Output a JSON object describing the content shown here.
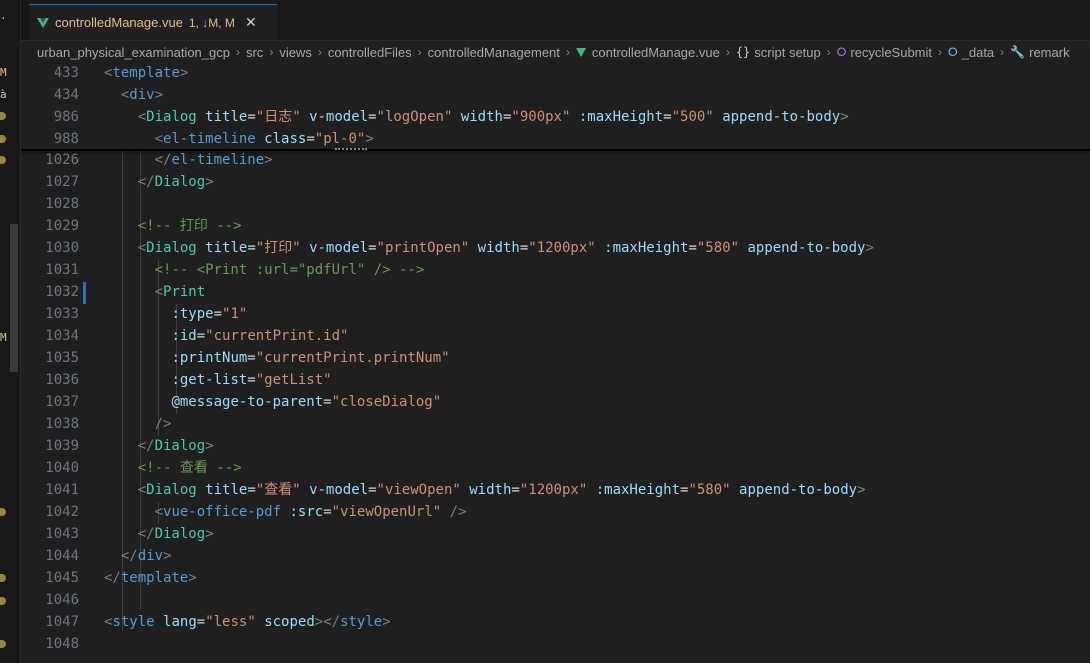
{
  "tab": {
    "filename": "controlledManage.vue",
    "status": "1, ↓M, M",
    "close": "✕"
  },
  "left_strip": {
    "marks": [
      "·",
      "M",
      "à",
      "M"
    ]
  },
  "breadcrumb": [
    {
      "label": "urban_physical_examination_gcp",
      "icon": ""
    },
    {
      "label": "src",
      "icon": ""
    },
    {
      "label": "views",
      "icon": ""
    },
    {
      "label": "controlledFiles",
      "icon": ""
    },
    {
      "label": "controlledManagement",
      "icon": ""
    },
    {
      "label": "controlledManage.vue",
      "icon": "vue-icon"
    },
    {
      "label": "script setup",
      "icon": "braces-icon"
    },
    {
      "label": "recycleSubmit",
      "icon": "method-icon"
    },
    {
      "label": "_data",
      "icon": "field-icon"
    },
    {
      "label": "remark",
      "icon": "wrench-icon"
    }
  ],
  "icon_glyphs": {
    "braces-icon": "{}",
    "method-icon": "⭘",
    "field-icon": "⭘",
    "wrench-icon": "🔧"
  },
  "colors": {
    "accent": "#0078d4",
    "modified": "#e2c08d",
    "tag": "#569cd6",
    "attribute": "#9cdcfe",
    "string": "#ce9178",
    "comment": "#6a9955"
  },
  "sticky_lines": [
    {
      "number": "433",
      "tokens": [
        [
          "t-br",
          "<"
        ],
        [
          "t-tag",
          "template"
        ],
        [
          "t-br",
          ">"
        ]
      ]
    },
    {
      "number": "434",
      "tokens": [
        [
          "t-plain",
          "  "
        ],
        [
          "t-br",
          "<"
        ],
        [
          "t-tag",
          "div"
        ],
        [
          "t-br",
          ">"
        ]
      ]
    },
    {
      "number": "986",
      "tokens": [
        [
          "t-plain",
          "    "
        ],
        [
          "t-br",
          "<"
        ],
        [
          "t-comp",
          "Dialog"
        ],
        [
          "t-plain",
          " "
        ],
        [
          "t-attr",
          "title"
        ],
        [
          "t-eq",
          "="
        ],
        [
          "t-str",
          "\"日志\""
        ],
        [
          "t-plain",
          " "
        ],
        [
          "t-attr",
          "v-model"
        ],
        [
          "t-eq",
          "="
        ],
        [
          "t-str",
          "\"logOpen\""
        ],
        [
          "t-plain",
          " "
        ],
        [
          "t-attr",
          "width"
        ],
        [
          "t-eq",
          "="
        ],
        [
          "t-str",
          "\"900px\""
        ],
        [
          "t-plain",
          " "
        ],
        [
          "t-attr",
          ":maxHeight"
        ],
        [
          "t-eq",
          "="
        ],
        [
          "t-str",
          "\"500\""
        ],
        [
          "t-plain",
          " "
        ],
        [
          "t-attr",
          "append-to-body"
        ],
        [
          "t-br",
          ">"
        ]
      ]
    },
    {
      "number": "988",
      "tokens": [
        [
          "t-plain",
          "      "
        ],
        [
          "t-br",
          "<"
        ],
        [
          "t-tag",
          "el-timeline"
        ],
        [
          "t-plain",
          " "
        ],
        [
          "t-attr",
          "class"
        ],
        [
          "t-eq",
          "="
        ],
        [
          "t-str",
          "\"pl-0\""
        ],
        [
          "t-br",
          ">"
        ]
      ]
    }
  ],
  "lines": [
    {
      "number": "1026",
      "tokens": [
        [
          "t-plain",
          "      "
        ],
        [
          "t-br",
          "</"
        ],
        [
          "t-tag",
          "el-timeline"
        ],
        [
          "t-br",
          ">"
        ]
      ]
    },
    {
      "number": "1027",
      "tokens": [
        [
          "t-plain",
          "    "
        ],
        [
          "t-br",
          "</"
        ],
        [
          "t-comp",
          "Dialog"
        ],
        [
          "t-br",
          ">"
        ]
      ]
    },
    {
      "number": "1028",
      "tokens": []
    },
    {
      "number": "1029",
      "tokens": [
        [
          "t-plain",
          "    "
        ],
        [
          "t-comment",
          "<!-- 打印 -->"
        ]
      ]
    },
    {
      "number": "1030",
      "tokens": [
        [
          "t-plain",
          "    "
        ],
        [
          "t-br",
          "<"
        ],
        [
          "t-comp",
          "Dialog"
        ],
        [
          "t-plain",
          " "
        ],
        [
          "t-attr",
          "title"
        ],
        [
          "t-eq",
          "="
        ],
        [
          "t-str",
          "\"打印\""
        ],
        [
          "t-plain",
          " "
        ],
        [
          "t-attr",
          "v-model"
        ],
        [
          "t-eq",
          "="
        ],
        [
          "t-str",
          "\"printOpen\""
        ],
        [
          "t-plain",
          " "
        ],
        [
          "t-attr",
          "width"
        ],
        [
          "t-eq",
          "="
        ],
        [
          "t-str",
          "\"1200px\""
        ],
        [
          "t-plain",
          " "
        ],
        [
          "t-attr",
          ":maxHeight"
        ],
        [
          "t-eq",
          "="
        ],
        [
          "t-str",
          "\"580\""
        ],
        [
          "t-plain",
          " "
        ],
        [
          "t-attr",
          "append-to-body"
        ],
        [
          "t-br",
          ">"
        ]
      ]
    },
    {
      "number": "1031",
      "tokens": [
        [
          "t-plain",
          "      "
        ],
        [
          "t-comment",
          "<!-- <Print :url=\"pdfUrl\" /> -->"
        ]
      ]
    },
    {
      "number": "1032",
      "tokens": [
        [
          "t-plain",
          "      "
        ],
        [
          "t-br",
          "<"
        ],
        [
          "t-comp",
          "Print"
        ]
      ]
    },
    {
      "number": "1033",
      "tokens": [
        [
          "t-plain",
          "        "
        ],
        [
          "t-attr",
          ":type"
        ],
        [
          "t-eq",
          "="
        ],
        [
          "t-str",
          "\"1\""
        ]
      ]
    },
    {
      "number": "1034",
      "tokens": [
        [
          "t-plain",
          "        "
        ],
        [
          "t-attr",
          ":id"
        ],
        [
          "t-eq",
          "="
        ],
        [
          "t-str",
          "\"currentPrint.id\""
        ]
      ]
    },
    {
      "number": "1035",
      "tokens": [
        [
          "t-plain",
          "        "
        ],
        [
          "t-attr",
          ":printNum"
        ],
        [
          "t-eq",
          "="
        ],
        [
          "t-str",
          "\"currentPrint.printNum\""
        ]
      ]
    },
    {
      "number": "1036",
      "tokens": [
        [
          "t-plain",
          "        "
        ],
        [
          "t-attr",
          ":get-list"
        ],
        [
          "t-eq",
          "="
        ],
        [
          "t-str",
          "\"getList\""
        ]
      ]
    },
    {
      "number": "1037",
      "tokens": [
        [
          "t-plain",
          "        "
        ],
        [
          "t-attr",
          "@message-to-parent"
        ],
        [
          "t-eq",
          "="
        ],
        [
          "t-str",
          "\"closeDialog\""
        ]
      ]
    },
    {
      "number": "1038",
      "tokens": [
        [
          "t-plain",
          "      "
        ],
        [
          "t-br",
          "/>"
        ]
      ]
    },
    {
      "number": "1039",
      "tokens": [
        [
          "t-plain",
          "    "
        ],
        [
          "t-br",
          "</"
        ],
        [
          "t-comp",
          "Dialog"
        ],
        [
          "t-br",
          ">"
        ]
      ]
    },
    {
      "number": "1040",
      "tokens": [
        [
          "t-plain",
          "    "
        ],
        [
          "t-comment",
          "<!-- 查看 -->"
        ]
      ]
    },
    {
      "number": "1041",
      "tokens": [
        [
          "t-plain",
          "    "
        ],
        [
          "t-br",
          "<"
        ],
        [
          "t-comp",
          "Dialog"
        ],
        [
          "t-plain",
          " "
        ],
        [
          "t-attr",
          "title"
        ],
        [
          "t-eq",
          "="
        ],
        [
          "t-str",
          "\"查看\""
        ],
        [
          "t-plain",
          " "
        ],
        [
          "t-attr",
          "v-model"
        ],
        [
          "t-eq",
          "="
        ],
        [
          "t-str",
          "\"viewOpen\""
        ],
        [
          "t-plain",
          " "
        ],
        [
          "t-attr",
          "width"
        ],
        [
          "t-eq",
          "="
        ],
        [
          "t-str",
          "\"1200px\""
        ],
        [
          "t-plain",
          " "
        ],
        [
          "t-attr",
          ":maxHeight"
        ],
        [
          "t-eq",
          "="
        ],
        [
          "t-str",
          "\"580\""
        ],
        [
          "t-plain",
          " "
        ],
        [
          "t-attr",
          "append-to-body"
        ],
        [
          "t-br",
          ">"
        ]
      ]
    },
    {
      "number": "1042",
      "tokens": [
        [
          "t-plain",
          "      "
        ],
        [
          "t-br",
          "<"
        ],
        [
          "t-tag",
          "vue-office-pdf"
        ],
        [
          "t-plain",
          " "
        ],
        [
          "t-attr",
          ":src"
        ],
        [
          "t-eq",
          "="
        ],
        [
          "t-str",
          "\"viewOpenUrl\""
        ],
        [
          "t-plain",
          " "
        ],
        [
          "t-br",
          "/>"
        ]
      ]
    },
    {
      "number": "1043",
      "tokens": [
        [
          "t-plain",
          "    "
        ],
        [
          "t-br",
          "</"
        ],
        [
          "t-comp",
          "Dialog"
        ],
        [
          "t-br",
          ">"
        ]
      ]
    },
    {
      "number": "1044",
      "tokens": [
        [
          "t-plain",
          "  "
        ],
        [
          "t-br",
          "</"
        ],
        [
          "t-tag",
          "div"
        ],
        [
          "t-br",
          ">"
        ]
      ]
    },
    {
      "number": "1045",
      "tokens": [
        [
          "t-br",
          "</"
        ],
        [
          "t-tag",
          "template"
        ],
        [
          "t-br",
          ">"
        ]
      ]
    },
    {
      "number": "1046",
      "tokens": []
    },
    {
      "number": "1047",
      "tokens": [
        [
          "t-br",
          "<"
        ],
        [
          "t-tag",
          "style"
        ],
        [
          "t-plain",
          " "
        ],
        [
          "t-attr",
          "lang"
        ],
        [
          "t-eq",
          "="
        ],
        [
          "t-str",
          "\"less\""
        ],
        [
          "t-plain",
          " "
        ],
        [
          "t-attr",
          "scoped"
        ],
        [
          "t-br",
          "></"
        ],
        [
          "t-tag",
          "style"
        ],
        [
          "t-br",
          ">"
        ]
      ]
    },
    {
      "number": "1048",
      "tokens": []
    }
  ]
}
